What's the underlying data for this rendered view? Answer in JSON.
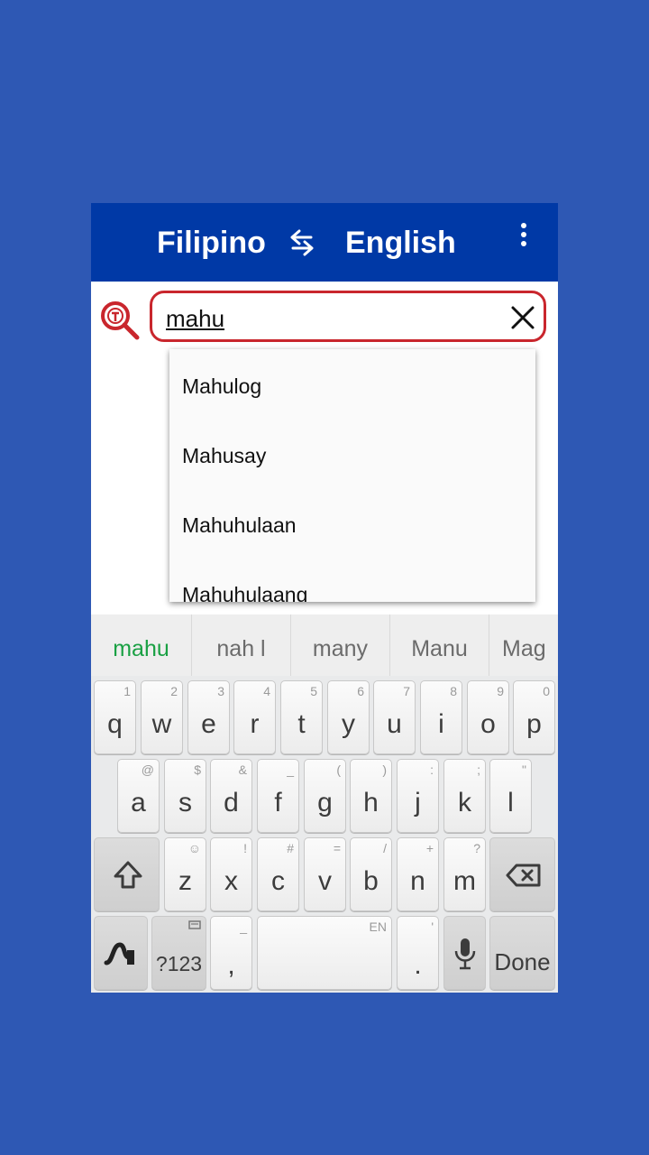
{
  "appbar": {
    "from_lang": "Filipino",
    "to_lang": "English",
    "swap_icon": "swap-arrows-icon",
    "menu_icon": "more-vert-icon",
    "bg_color": "#0039a6"
  },
  "search": {
    "value": "mahu",
    "logo_icon": "translate-search-icon",
    "clear_icon": "close-icon",
    "border_color": "#c9262d"
  },
  "suggestions": [
    "Mahulog",
    "Mahusay",
    "Mahuhulaan",
    "Mahuhulaang"
  ],
  "keyboard": {
    "candidates": [
      "mahu",
      "nah l",
      "many",
      "Manu",
      "Mag"
    ],
    "row1": [
      {
        "key": "q",
        "hint": "1"
      },
      {
        "key": "w",
        "hint": "2"
      },
      {
        "key": "e",
        "hint": "3"
      },
      {
        "key": "r",
        "hint": "4"
      },
      {
        "key": "t",
        "hint": "5"
      },
      {
        "key": "y",
        "hint": "6"
      },
      {
        "key": "u",
        "hint": "7"
      },
      {
        "key": "i",
        "hint": "8"
      },
      {
        "key": "o",
        "hint": "9"
      },
      {
        "key": "p",
        "hint": "0"
      }
    ],
    "row2": [
      {
        "key": "a",
        "hint": "@"
      },
      {
        "key": "s",
        "hint": "$"
      },
      {
        "key": "d",
        "hint": "&"
      },
      {
        "key": "f",
        "hint": "_"
      },
      {
        "key": "g",
        "hint": "("
      },
      {
        "key": "h",
        "hint": ")"
      },
      {
        "key": "j",
        "hint": ":"
      },
      {
        "key": "k",
        "hint": ";"
      },
      {
        "key": "l",
        "hint": "\""
      }
    ],
    "row3": [
      {
        "key": "z",
        "hint": "☺"
      },
      {
        "key": "x",
        "hint": "!"
      },
      {
        "key": "c",
        "hint": "#"
      },
      {
        "key": "v",
        "hint": "="
      },
      {
        "key": "b",
        "hint": "/"
      },
      {
        "key": "n",
        "hint": "+"
      },
      {
        "key": "m",
        "hint": "?"
      }
    ],
    "row4": {
      "symbols_label": "?123",
      "comma": ",",
      "comma_hint": "_",
      "space_hint": "EN",
      "period": ".",
      "period_hint": "'",
      "done_label": "Done"
    },
    "icons": {
      "shift": "shift-icon",
      "backspace": "backspace-icon",
      "swype": "swype-icon",
      "mic": "microphone-icon",
      "symbols": "keyboard-layout-icon"
    },
    "primary_candidate_color": "#19a043"
  }
}
